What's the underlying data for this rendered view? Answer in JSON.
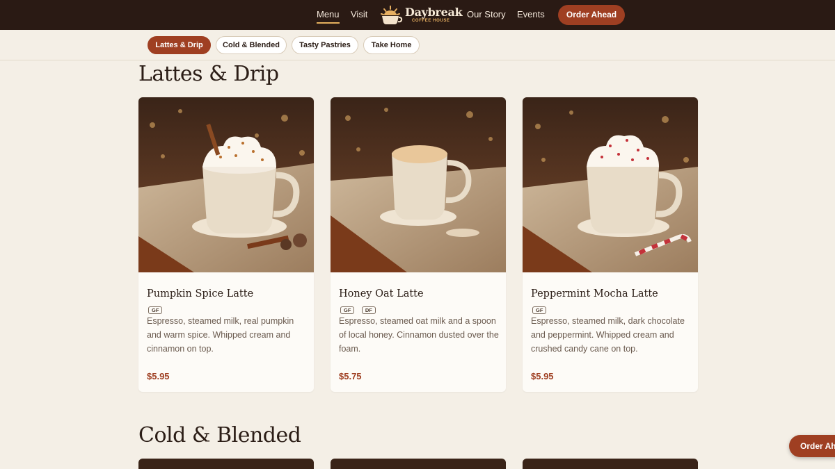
{
  "nav": {
    "links": [
      "Menu",
      "Visit",
      "Our Story",
      "Events"
    ],
    "brand": "Daybreak",
    "brand_sub": "COFFEE HOUSE",
    "order_label": "Order Ahead"
  },
  "categories": [
    "Lattes & Drip",
    "Cold & Blended",
    "Tasty Pastries",
    "Take Home"
  ],
  "sections": {
    "lattes_title": "Lattes & Drip",
    "cold_title": "Cold & Blended"
  },
  "items": [
    {
      "name": "Pumpkin Spice Latte",
      "tags": [
        "GF"
      ],
      "desc": "Espresso, steamed milk, real pumpkin and warm spice. Whipped cream and cinnamon on top.",
      "price": "$5.95",
      "topping": "pumpkin"
    },
    {
      "name": "Honey Oat Latte",
      "tags": [
        "GF",
        "DF"
      ],
      "desc": "Espresso, steamed oat milk and a spoon of local honey. Cinnamon dusted over the foam.",
      "price": "$5.75",
      "topping": "foam"
    },
    {
      "name": "Peppermint Mocha Latte",
      "tags": [
        "GF"
      ],
      "desc": "Espresso, steamed milk, dark chocolate and peppermint. Whipped cream and crushed candy cane on top.",
      "price": "$5.95",
      "topping": "peppermint"
    }
  ],
  "float_order_label": "Order Ahead",
  "colors": {
    "accent": "#9f3f22",
    "nav_bg": "#2a1a14",
    "page_bg": "#f4efe6",
    "underline": "#e6b15e"
  }
}
